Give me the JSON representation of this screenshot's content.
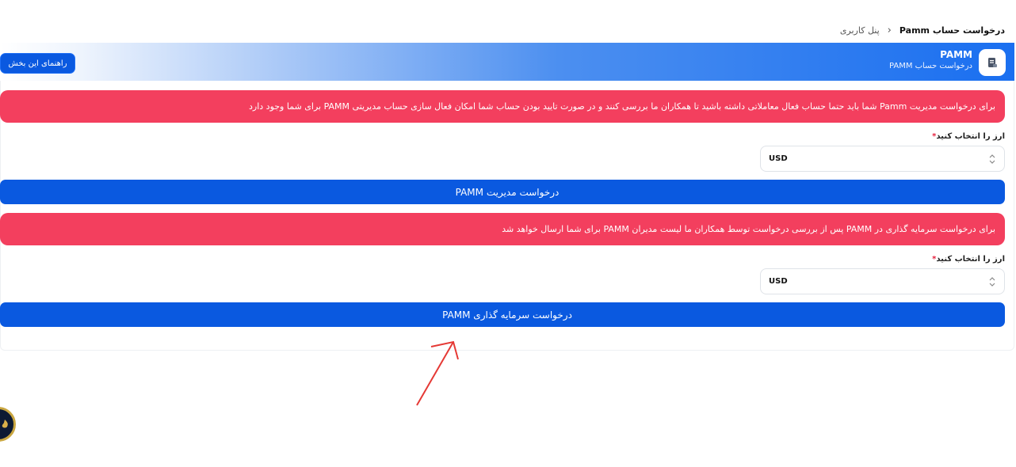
{
  "breadcrumb": {
    "home": "پنل کاربری",
    "current": "درخواست حساب Pamm"
  },
  "header": {
    "title": "PAMM",
    "subtitle": "درخواست حساب PAMM",
    "guide_button": "راهنمای این بخش"
  },
  "manager_section": {
    "alert": "برای درخواست مدیریت Pamm شما باید حتما حساب فعال معاملاتی داشته باشید تا همکاران ما بررسی کنند و در صورت تایید بودن حساب شما امکان فعال سازی حساب مدیریتی PAMM برای شما وجود دارد",
    "currency_label": "ارز را انتخاب کنید",
    "required_mark": "*",
    "currency_value": "USD",
    "submit_label": "درخواست مدیریت PAMM"
  },
  "investor_section": {
    "alert": "برای درخواست سرمایه گذاری در PAMM پس از بررسی درخواست توسط همکاران ما لیست مدیران PAMM برای شما ارسال خواهد شد",
    "currency_label": "ارز را انتخاب کنید",
    "required_mark": "*",
    "currency_value": "USD",
    "submit_label": "درخواست سرمایه گذاری PAMM"
  },
  "colors": {
    "primary": "#0a59e0",
    "alert": "#f33f5e",
    "annotation_arrow": "#e53935"
  }
}
